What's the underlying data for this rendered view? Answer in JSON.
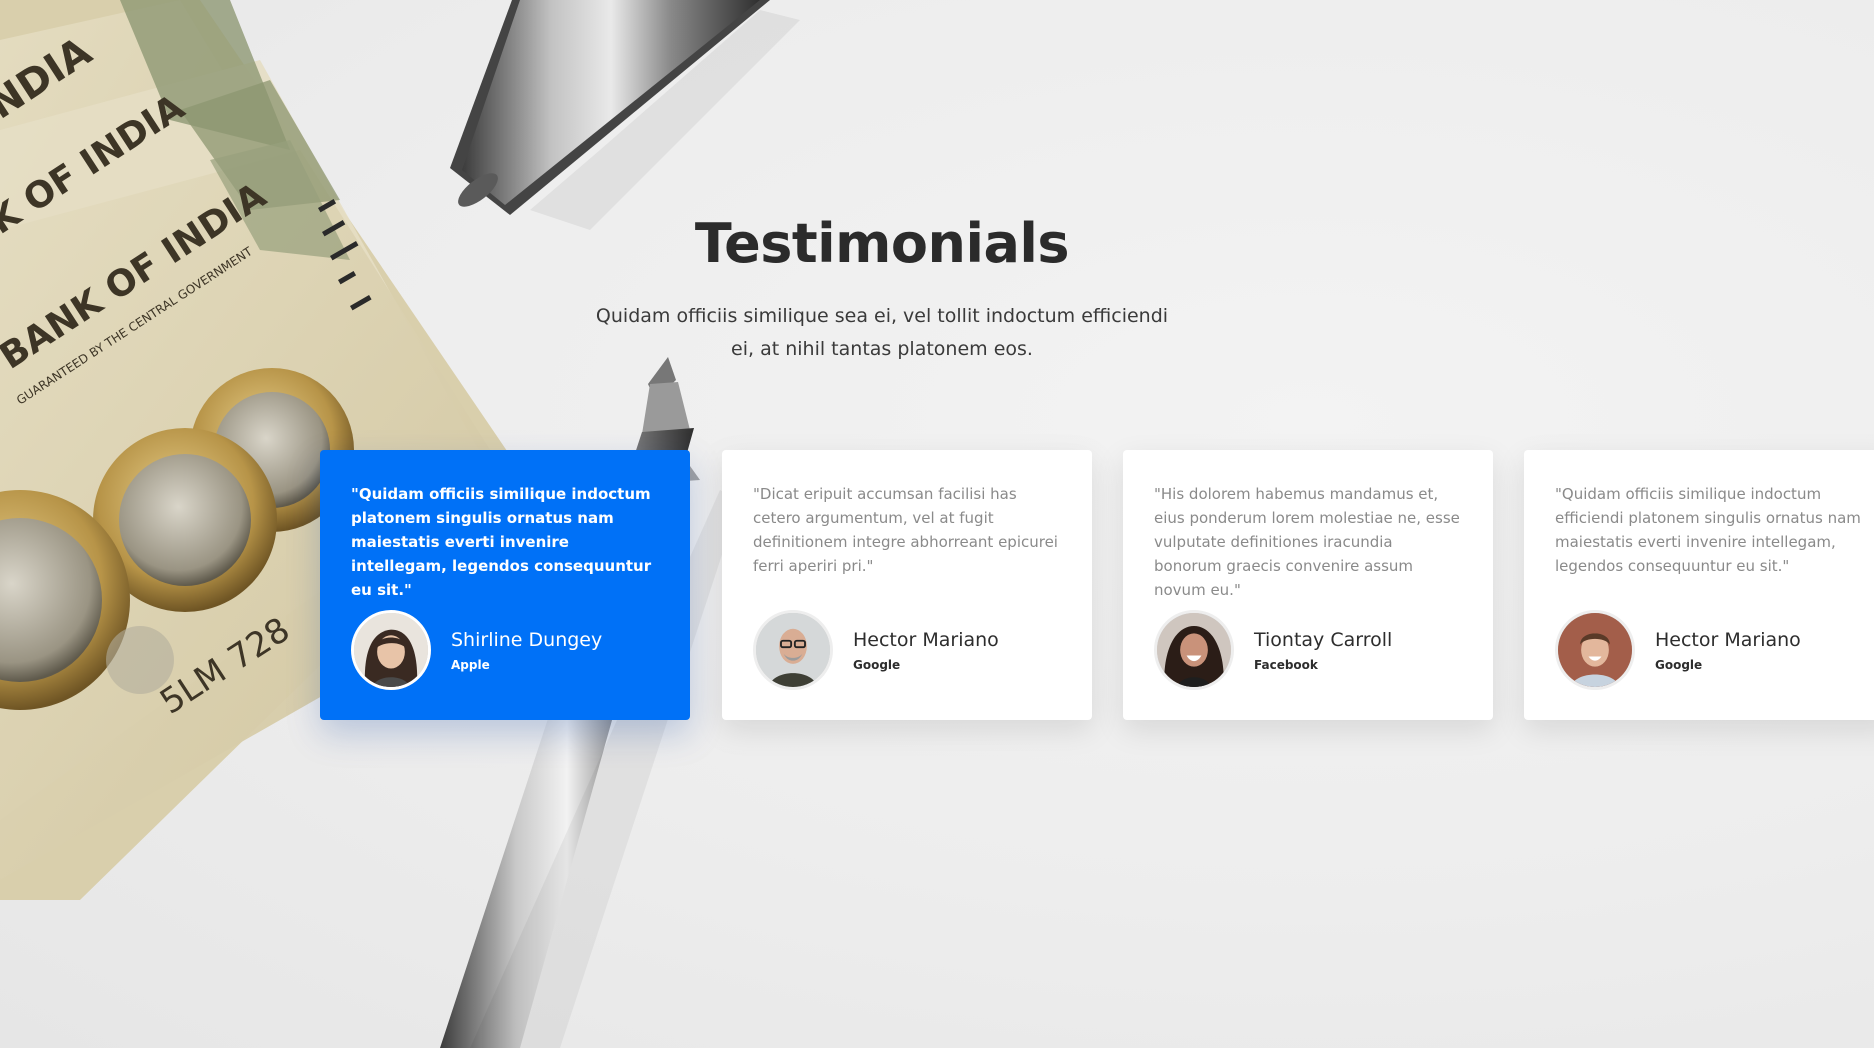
{
  "section": {
    "title": "Testimonials",
    "subtitle": "Quidam officiis similique sea ei, vel tollit indoctum efficiendi ei, at nihil tantas platonem eos."
  },
  "colors": {
    "accent": "#0071f7",
    "card_bg": "#ffffff",
    "page_bg": "#ededed"
  },
  "testimonials": [
    {
      "quote": "\"Quidam officiis similique indoctum platonem singulis ornatus nam maiestatis everti invenire intellegam, legendos consequuntur eu sit.\"",
      "name": "Shirline Dungey",
      "company": "Apple",
      "active": true
    },
    {
      "quote": "\"Dicat eripuit accumsan facilisi has cetero argumentum, vel at fugit definitionem integre abhorreant epicurei ferri aperiri pri.\"",
      "name": "Hector Mariano",
      "company": "Google",
      "active": false
    },
    {
      "quote": "\"His dolorem habemus mandamus et, eius ponderum lorem molestiae ne, esse vulputate definitiones iracundia bonorum graecis convenire assum novum eu.\"",
      "name": "Tiontay Carroll",
      "company": "Facebook",
      "active": false
    },
    {
      "quote": "\"Quidam officiis similique indoctum efficiendi platonem singulis ornatus nam maiestatis everti invenire intellegam, legendos consequuntur eu sit.\"",
      "name": "Hector Mariano",
      "company": "Google",
      "active": false
    }
  ],
  "background_art": {
    "banknote_text": [
      "BANK OF INDIA",
      "K OF INDIA",
      "NDIA",
      "GUARANTEED BY THE CENTRAL GOVERNMENT",
      "5LM 728"
    ]
  }
}
